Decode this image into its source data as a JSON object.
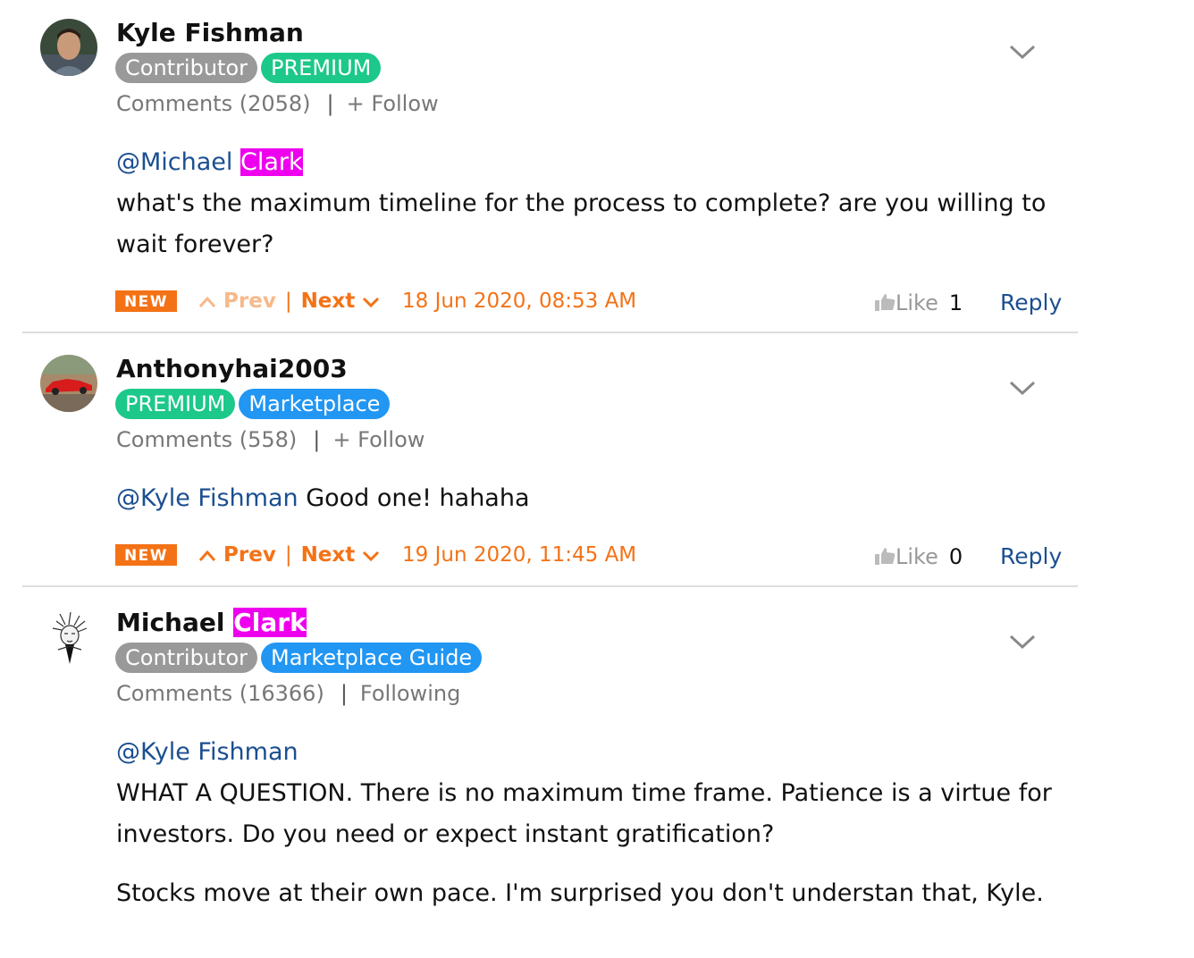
{
  "comments": [
    {
      "username": "Kyle Fishman",
      "badges": [
        "Contributor",
        "PREMIUM"
      ],
      "comments_label": "Comments",
      "comments_count": "(2058)",
      "follow_label": "+ Follow",
      "mention_first": "@Michael",
      "mention_last": "Clark",
      "text": "what's the maximum timeline for the process to complete? are you willing to wait forever?",
      "new_tag": "NEW",
      "prev_label": "Prev",
      "next_label": "Next",
      "date": "18 Jun 2020, 08:53 AM",
      "like_label": "Like",
      "like_count": "1",
      "reply_label": "Reply"
    },
    {
      "username": "Anthonyhai2003",
      "badges": [
        "PREMIUM",
        "Marketplace"
      ],
      "comments_label": "Comments",
      "comments_count": "(558)",
      "follow_label": "+ Follow",
      "mention": "@Kyle Fishman",
      "text": " Good one! hahaha",
      "new_tag": "NEW",
      "prev_label": "Prev",
      "next_label": "Next",
      "date": "19 Jun 2020, 11:45 AM",
      "like_label": "Like",
      "like_count": "0",
      "reply_label": "Reply"
    },
    {
      "username_first": "Michael",
      "username_last": "Clark",
      "badges": [
        "Contributor",
        "Marketplace Guide"
      ],
      "comments_label": "Comments",
      "comments_count": "(16366)",
      "follow_label": "Following",
      "mention": "@Kyle Fishman",
      "paragraph1": "WHAT A QUESTION. There is no maximum time frame. Patience is a virtue for investors. Do you need or expect instant gratification?",
      "paragraph2": "Stocks move at their own pace. I'm surprised you don't understan that, Kyle."
    }
  ],
  "colors": {
    "accent_orange": "#f47216",
    "mention_blue": "#1b4f91",
    "premium_green": "#1cc88a",
    "marketplace_blue": "#2196f3",
    "contributor_gray": "#999999",
    "highlight_magenta": "#ee00ee"
  }
}
